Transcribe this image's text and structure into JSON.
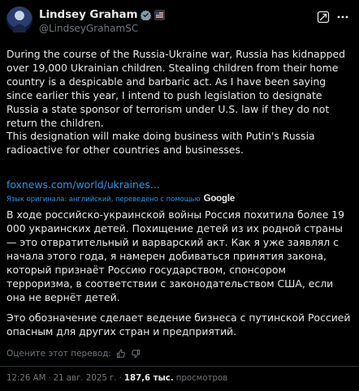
{
  "author": {
    "display_name": "Lindsey Graham",
    "handle": "@LindseyGrahamSC"
  },
  "icons": {
    "verified": "government-verified-badge-icon",
    "affiliation": "us-flag-icon",
    "grok": "grok-icon",
    "more": "more-dots-icon",
    "thumbs_up": "thumbs-up-icon",
    "thumbs_down": "thumbs-down-icon"
  },
  "colors": {
    "background": "#000000",
    "text": "#e7e9ea",
    "muted": "#71767b",
    "link": "#1d9bf0"
  },
  "tweet": {
    "paragraph_1": "During the course of the Russia-Ukraine war, Russia has kidnapped over 19,000 Ukrainian children. Stealing children from their home country is a despicable and barbaric act. As I have been saying since earlier this year, I intend to push legislation to designate Russia a state sponsor of terrorism under U.S. law if they do not return the children.",
    "paragraph_2": "This designation will make doing business with Putin's Russia radioactive for other countries and businesses.",
    "link": "foxnews.com/world/ukraines..."
  },
  "translation": {
    "note": "Язык оригинала: английский, переведено с помощью",
    "provider": "Google",
    "paragraph_1": "В ходе российско-украинской войны Россия похитила более 19 000 украинских детей. Похищение детей из их родной страны — это отвратительный и варварский акт. Как я уже заявлял с начала этого года, я намерен добиваться принятия закона, который признаёт Россию государством, спонсором терроризма, в соответствии с законодательством США, если она не вернёт детей.",
    "paragraph_2": "Это обозначение сделает ведение бизнеса с путинской Россией опасным для других стран и предприятий.",
    "rate_label": "Оцените этот перевод:"
  },
  "meta": {
    "time": "12:26 AM",
    "separator": "·",
    "date": "21 авг. 2025 г.",
    "views_count": "187,6 тыс.",
    "views_label": "просмотров"
  }
}
